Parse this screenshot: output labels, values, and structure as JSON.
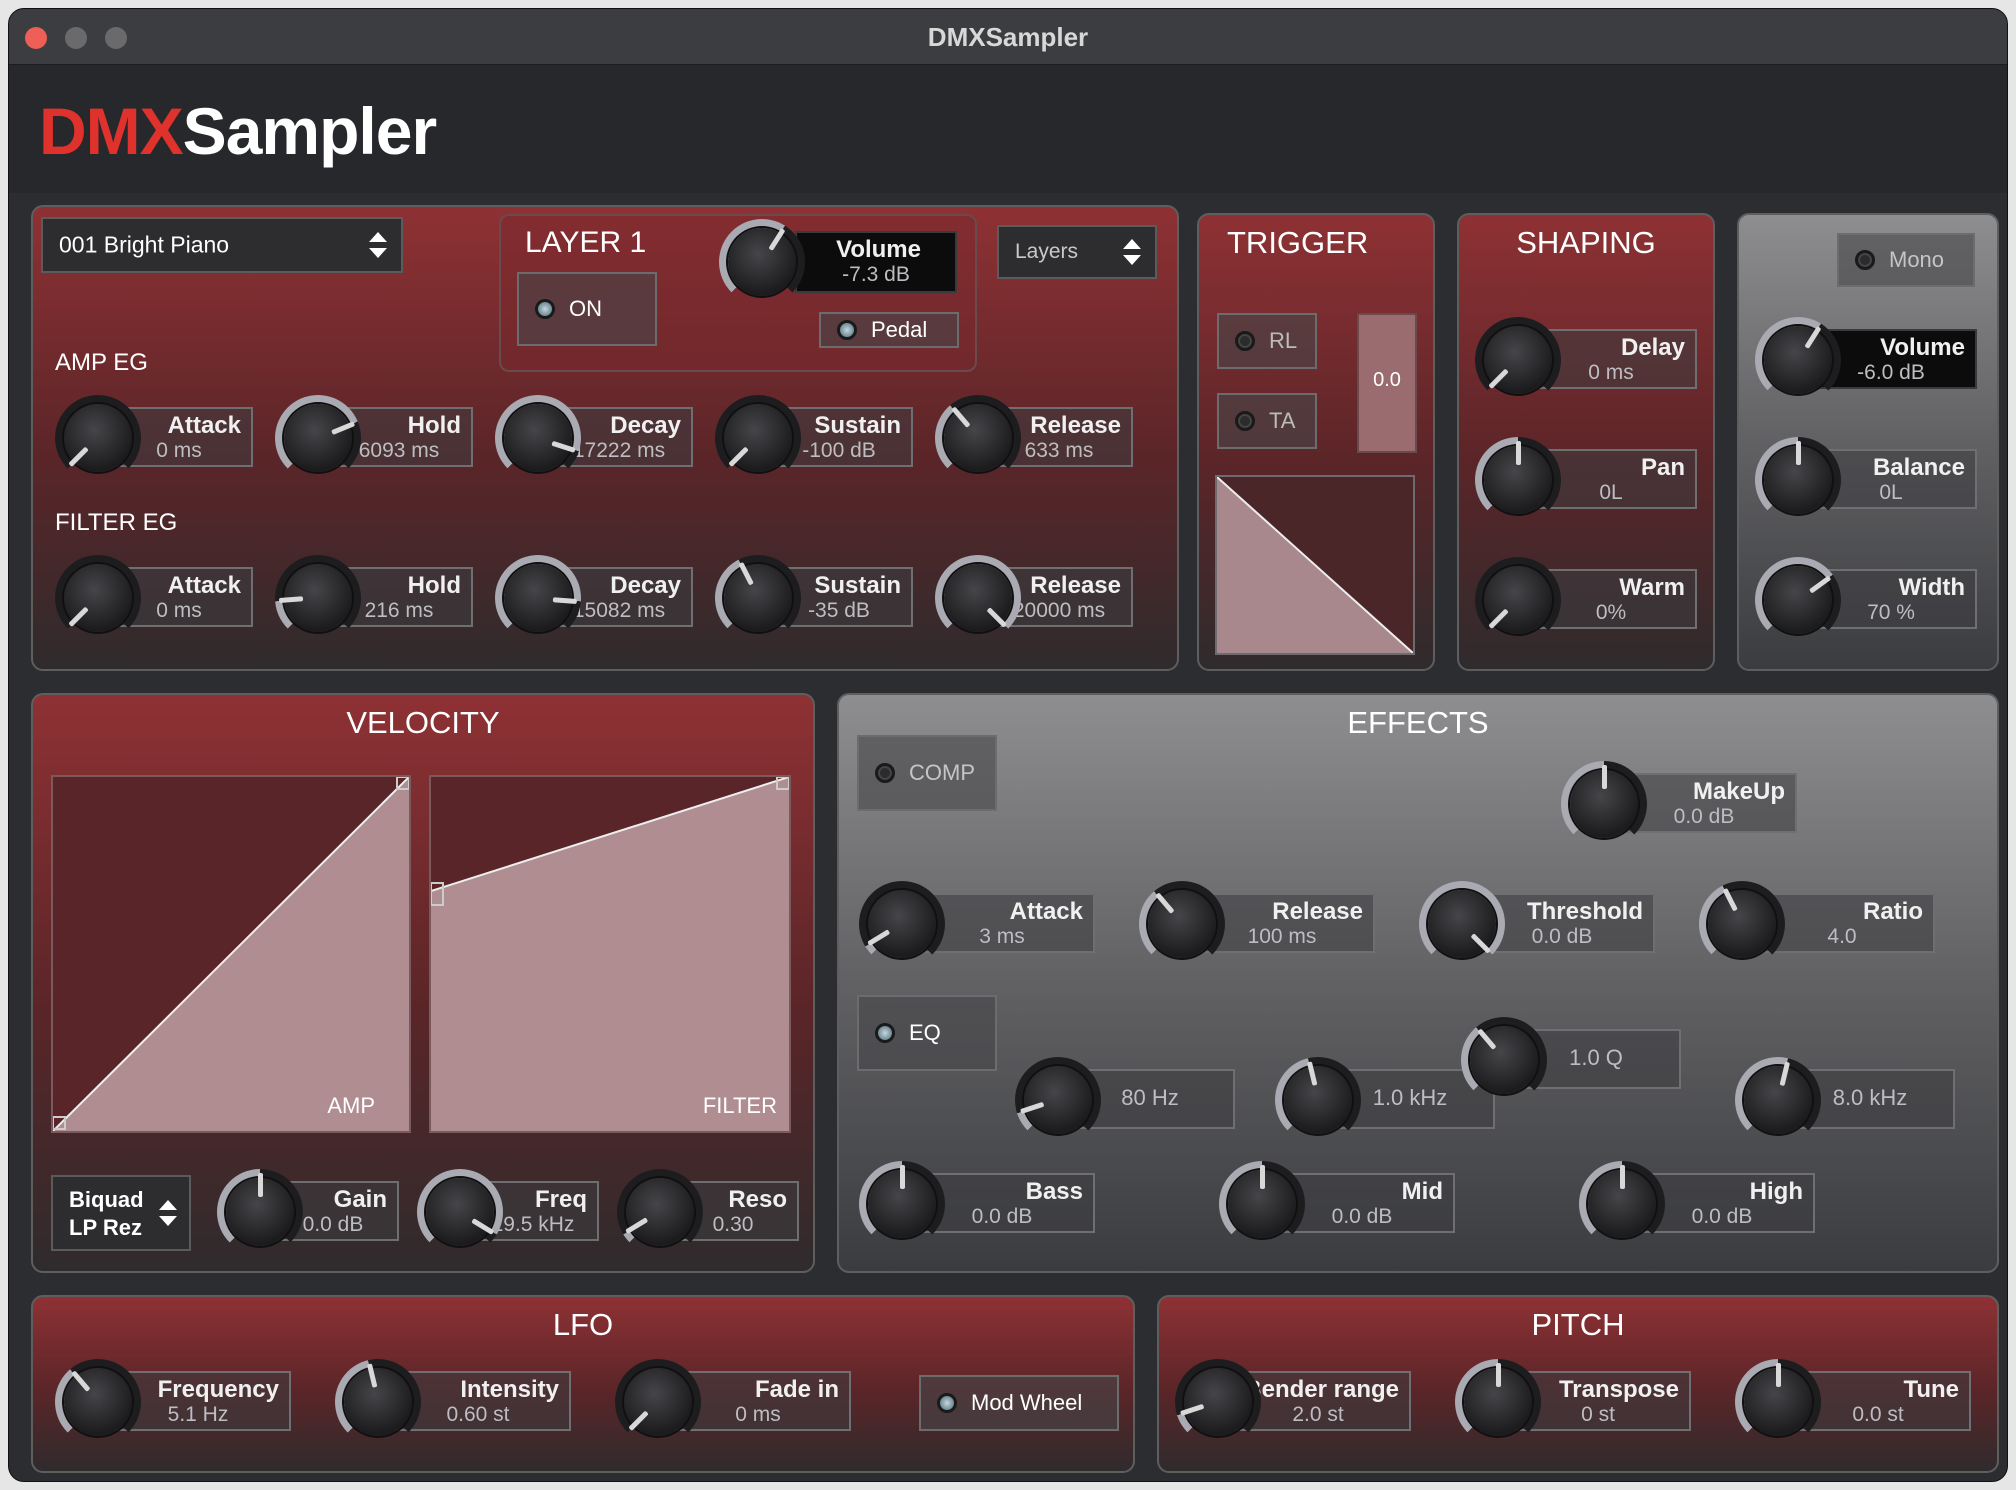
{
  "window": {
    "title": "DMXSampler"
  },
  "brand": {
    "part1": "DMX",
    "part2": "Sampler"
  },
  "preset": {
    "name": "001 Bright Piano"
  },
  "layer": {
    "title": "LAYER 1",
    "on_label": "ON",
    "pedal_label": "Pedal",
    "layers_select": "Layers",
    "volume": {
      "label": "Volume",
      "value": "-7.3 dB",
      "level": 0.62
    }
  },
  "amp_eg": {
    "title": "AMP EG",
    "knobs": [
      {
        "label": "Attack",
        "value": "0 ms",
        "level": 0.0
      },
      {
        "label": "Hold",
        "value": "6093 ms",
        "level": 0.75
      },
      {
        "label": "Decay",
        "value": "17222 ms",
        "level": 0.9
      },
      {
        "label": "Sustain",
        "value": "-100 dB",
        "level": 0.0
      },
      {
        "label": "Release",
        "value": "633 ms",
        "level": 0.35
      }
    ]
  },
  "filter_eg": {
    "title": "FILTER EG",
    "knobs": [
      {
        "label": "Attack",
        "value": "0 ms",
        "level": 0.0
      },
      {
        "label": "Hold",
        "value": "216 ms",
        "level": 0.15
      },
      {
        "label": "Decay",
        "value": "15082 ms",
        "level": 0.85
      },
      {
        "label": "Sustain",
        "value": "-35 dB",
        "level": 0.4
      },
      {
        "label": "Release",
        "value": "20000 ms",
        "level": 1.0
      }
    ]
  },
  "trigger": {
    "title": "TRIGGER",
    "rl_label": "RL",
    "ta_label": "TA",
    "value": "0.0"
  },
  "shaping": {
    "title": "SHAPING",
    "knobs": [
      {
        "label": "Delay",
        "value": "0 ms",
        "level": 0.0
      },
      {
        "label": "Pan",
        "value": "0L",
        "level": 0.5
      },
      {
        "label": "Warm",
        "value": "0%",
        "level": 0.0
      }
    ]
  },
  "output": {
    "mono_label": "Mono",
    "volume": {
      "label": "Volume",
      "value": "-6.0 dB",
      "level": 0.62
    },
    "balance": {
      "label": "Balance",
      "value": "0L",
      "level": 0.5
    },
    "width": {
      "label": "Width",
      "value": "70 %",
      "level": 0.7
    }
  },
  "velocity": {
    "title": "VELOCITY",
    "amp_label": "AMP",
    "filter_label": "FILTER",
    "filter_type": {
      "line1": "Biquad",
      "line2": "LP Rez"
    },
    "knobs": [
      {
        "label": "Gain",
        "value": "0.0 dB",
        "level": 0.5
      },
      {
        "label": "Freq",
        "value": "19.5 kHz",
        "level": 0.95
      },
      {
        "label": "Reso",
        "value": "0.30",
        "level": 0.05
      }
    ]
  },
  "effects": {
    "title": "EFFECTS",
    "comp_label": "COMP",
    "eq_label": "EQ",
    "makeup": {
      "label": "MakeUp",
      "value": "0.0 dB",
      "level": 0.5
    },
    "comp_knobs": [
      {
        "label": "Attack",
        "value": "3 ms",
        "level": 0.05
      },
      {
        "label": "Release",
        "value": "100 ms",
        "level": 0.35
      },
      {
        "label": "Threshold",
        "value": "0.0 dB",
        "level": 1.0
      },
      {
        "label": "Ratio",
        "value": "4.0",
        "level": 0.4
      }
    ],
    "eq_freqs": [
      {
        "value": "80 Hz",
        "level": 0.1
      },
      {
        "value": "1.0 kHz",
        "level": 0.45
      },
      {
        "value": "1.0 Q",
        "level": 0.35
      },
      {
        "value": "8.0 kHz",
        "level": 0.55
      }
    ],
    "eq_gains": [
      {
        "label": "Bass",
        "value": "0.0 dB",
        "level": 0.5
      },
      {
        "label": "Mid",
        "value": "0.0 dB",
        "level": 0.5
      },
      {
        "label": "High",
        "value": "0.0 dB",
        "level": 0.5
      }
    ]
  },
  "lfo": {
    "title": "LFO",
    "mod_wheel_label": "Mod Wheel",
    "knobs": [
      {
        "label": "Frequency",
        "value": "5.1 Hz",
        "level": 0.35
      },
      {
        "label": "Intensity",
        "value": "0.60 st",
        "level": 0.45
      },
      {
        "label": "Fade in",
        "value": "0 ms",
        "level": 0.0
      }
    ]
  },
  "pitch": {
    "title": "PITCH",
    "knobs": [
      {
        "label": "Bender range",
        "value": "2.0 st",
        "level": 0.1
      },
      {
        "label": "Transpose",
        "value": "0 st",
        "level": 0.5
      },
      {
        "label": "Tune",
        "value": "0.0 st",
        "level": 0.5
      }
    ]
  },
  "colors": {
    "accent": "#e0322c",
    "panel_red": "#8e3134",
    "panel_gray": "#8e8e90"
  }
}
